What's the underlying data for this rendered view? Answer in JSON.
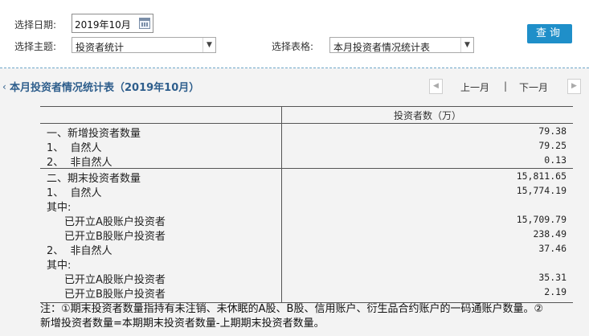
{
  "filters": {
    "date_label": "选择日期:",
    "date_value": "2019年10月",
    "topic_label": "选择主题:",
    "topic_value": "投资者统计",
    "table_label": "选择表格:",
    "table_value": "本月投资者情况统计表",
    "query_label": "查询"
  },
  "report": {
    "title": "本月投资者情况统计表（2019年10月）",
    "prev_label": "上一月",
    "separator": "|",
    "next_label": "下一月"
  },
  "table": {
    "header": "投资者数（万）",
    "rows": [
      {
        "label": "一、新增投资者数量",
        "value": "79.38"
      },
      {
        "label": "1、  自然人",
        "value": "79.25"
      },
      {
        "label": "2、  非自然人",
        "value": "0.13"
      },
      {
        "label": "二、期末投资者数量",
        "value": "15,811.65"
      },
      {
        "label": "1、  自然人",
        "value": "15,774.19"
      },
      {
        "label": "其中:",
        "value": ""
      },
      {
        "label": "已开立A股账户投资者",
        "value": "15,709.79"
      },
      {
        "label": "已开立B股账户投资者",
        "value": "238.49"
      },
      {
        "label": "2、  非自然人",
        "value": "37.46"
      },
      {
        "label": "其中:",
        "value": ""
      },
      {
        "label": "已开立A股账户投资者",
        "value": "35.31"
      },
      {
        "label": "已开立B股账户投资者",
        "value": "2.19"
      }
    ]
  },
  "notes": {
    "line1": "注：①期末投资者数量指持有未注销、未休眠的A股、B股、信用账户、衍生品合约账户的一码通账户数量。②",
    "line2": "新增投资者数量=本期期末投资者数量-上期期末投资者数量。"
  },
  "icons": [
    "calendar-icon",
    "dropdown-arrow-icon",
    "prev-arrow-icon",
    "next-arrow-icon"
  ],
  "colors": {
    "accent": "#1f8fc9",
    "title": "#2e5e8c",
    "content_bg": "#f3f3f3"
  }
}
